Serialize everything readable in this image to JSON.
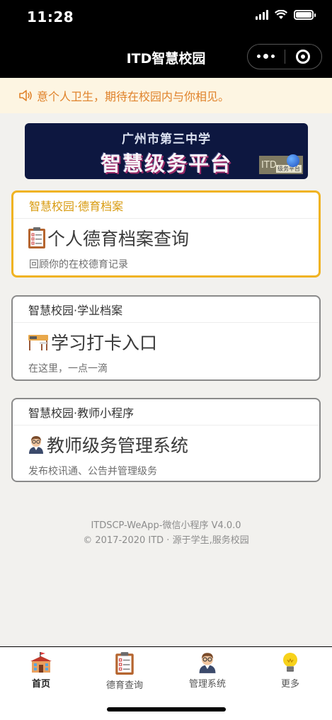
{
  "status": {
    "time": "11:28"
  },
  "nav": {
    "title": "ITD智慧校园"
  },
  "notice": {
    "text": "意个人卫生，期待在校园内与你相见。"
  },
  "banner": {
    "subtitle": "广州市第三中学",
    "title": "智慧级务平台",
    "badge_text": "ITD",
    "badge_tag": "级务平台"
  },
  "cards": [
    {
      "header": "智慧校园·德育档案",
      "title": "个人德育档案查询",
      "desc": "回顾你的在校德育记录",
      "icon": "clipboard-icon"
    },
    {
      "header": "智慧校园·学业档案",
      "title": "学习打卡入口",
      "desc": "在这里，一点一滴",
      "icon": "desk-icon"
    },
    {
      "header": "智慧校园·教师小程序",
      "title": "教师级务管理系统",
      "desc": "发布校讯通、公告并管理级务",
      "icon": "teacher-icon"
    }
  ],
  "footer": {
    "line1": "ITDSCP-WeApp-微信小程序 V4.0.0",
    "line2": "© 2017-2020 ITD · 源于学生,服务校园"
  },
  "tabs": [
    {
      "label": "首页",
      "icon": "school-icon",
      "active": true
    },
    {
      "label": "德育查询",
      "icon": "clipboard-icon",
      "active": false
    },
    {
      "label": "管理系统",
      "icon": "teacher-icon",
      "active": false
    },
    {
      "label": "更多",
      "icon": "lightbulb-icon",
      "active": false
    }
  ],
  "colors": {
    "accent": "#f0b323",
    "notice_text": "#e0832b",
    "notice_bg": "#fdf5e2",
    "banner_bg": "#0d1740"
  }
}
